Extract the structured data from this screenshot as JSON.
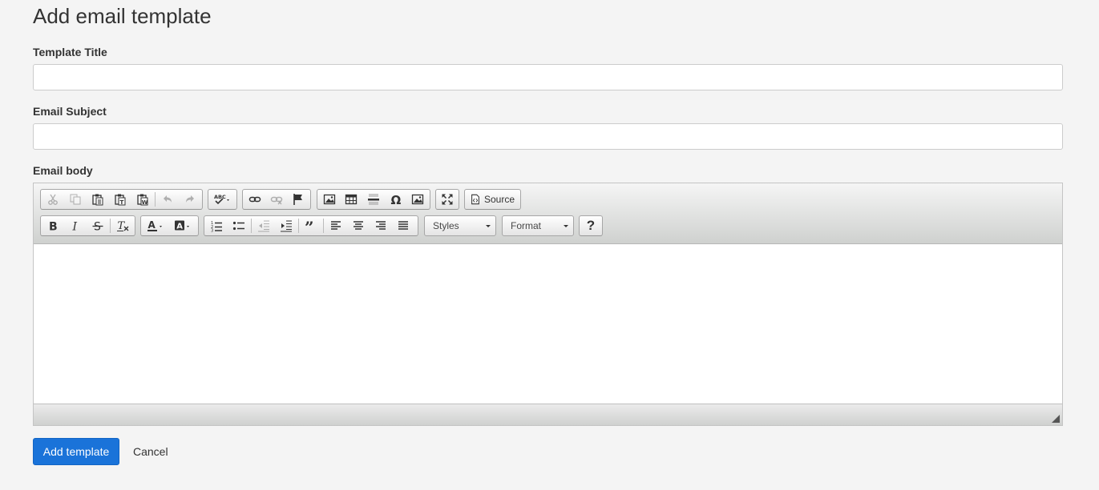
{
  "page": {
    "title": "Add email template"
  },
  "form": {
    "template_title_label": "Template Title",
    "template_title_value": "",
    "email_subject_label": "Email Subject",
    "email_subject_value": "",
    "email_body_label": "Email body"
  },
  "editor": {
    "source_label": "Source",
    "styles_label": "Styles",
    "format_label": "Format",
    "help_label": "?",
    "icons": [
      "cut-icon",
      "copy-icon",
      "paste-icon",
      "paste-text-icon",
      "paste-word-icon",
      "undo-icon",
      "redo-icon",
      "spellcheck-icon",
      "link-icon",
      "unlink-icon",
      "anchor-icon",
      "image-icon",
      "table-icon",
      "horizontal-rule-icon",
      "special-char-icon",
      "iframe-icon",
      "maximize-icon",
      "source-icon",
      "bold-icon",
      "italic-icon",
      "strike-icon",
      "remove-format-icon",
      "text-color-icon",
      "bg-color-icon",
      "numbered-list-icon",
      "bulleted-list-icon",
      "outdent-icon",
      "indent-icon",
      "blockquote-icon",
      "align-left-icon",
      "align-center-icon",
      "align-right-icon",
      "align-justify-icon",
      "help-icon",
      "resize-handle-icon"
    ]
  },
  "actions": {
    "submit_label": "Add template",
    "cancel_label": "Cancel"
  }
}
